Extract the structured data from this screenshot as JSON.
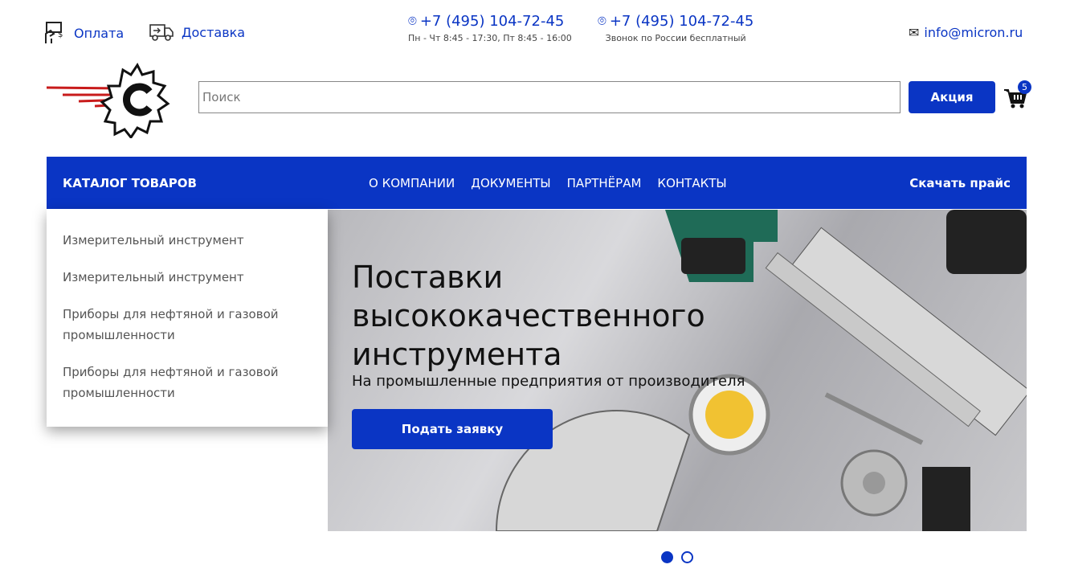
{
  "header": {
    "payment": "Оплата",
    "delivery": "Доставка",
    "phone1": "+7 (495) 104-72-45",
    "hours": "Пн - Чт 8:45 - 17:30, Пт 8:45 - 16:00",
    "phone2": "+7 (495) 104-72-45",
    "free_call": "Звонок по России бесплатный",
    "email": "info@micron.ru"
  },
  "search": {
    "placeholder": "Поиск",
    "value": ""
  },
  "promo_button": "Акция",
  "cart": {
    "count": "5"
  },
  "nav": {
    "catalog": "КАТАЛОГ ТОВАРОВ",
    "items": [
      "О КОМПАНИИ",
      "ДОКУМЕНТЫ",
      "ПАРТНЁРАМ",
      "КОНТАКТЫ"
    ],
    "price": "Скачать прайс"
  },
  "catalog_menu": [
    "Измерительный инструмент",
    "Измерительный инструмент",
    "Приборы для нефтяной и газовой промышленности",
    "Приборы для нефтяной и газовой промышленности"
  ],
  "banner": {
    "title": "Поставки высококачественного инструмента",
    "subtitle": "На промышленные предприятия от производителя",
    "cta": "Подать заявку"
  },
  "slider": {
    "active": 1,
    "total": 2
  },
  "colors": {
    "brand": "#0a35c4"
  }
}
